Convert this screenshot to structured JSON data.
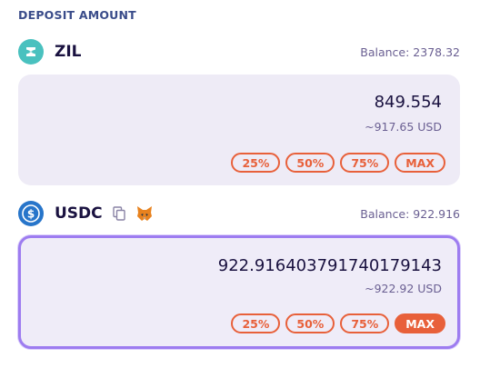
{
  "section_title": "DEPOSIT AMOUNT",
  "colors": {
    "accent": "#e8603a",
    "active_border": "#9d7cf0",
    "box_bg": "#eeebf6"
  },
  "token_a": {
    "symbol": "ZIL",
    "icon": "zil-icon",
    "balance": "Balance: 2378.32",
    "amount": "849.554",
    "usd": "~917.65 USD",
    "buttons": [
      "25%",
      "50%",
      "75%",
      "MAX"
    ]
  },
  "token_b": {
    "symbol": "USDC",
    "icon": "usdc-icon",
    "balance": "Balance: 922.916",
    "amount": "922.916403791740179143",
    "usd": "~922.92 USD",
    "buttons": [
      "25%",
      "50%",
      "75%",
      "MAX"
    ],
    "selected_button": "MAX"
  }
}
